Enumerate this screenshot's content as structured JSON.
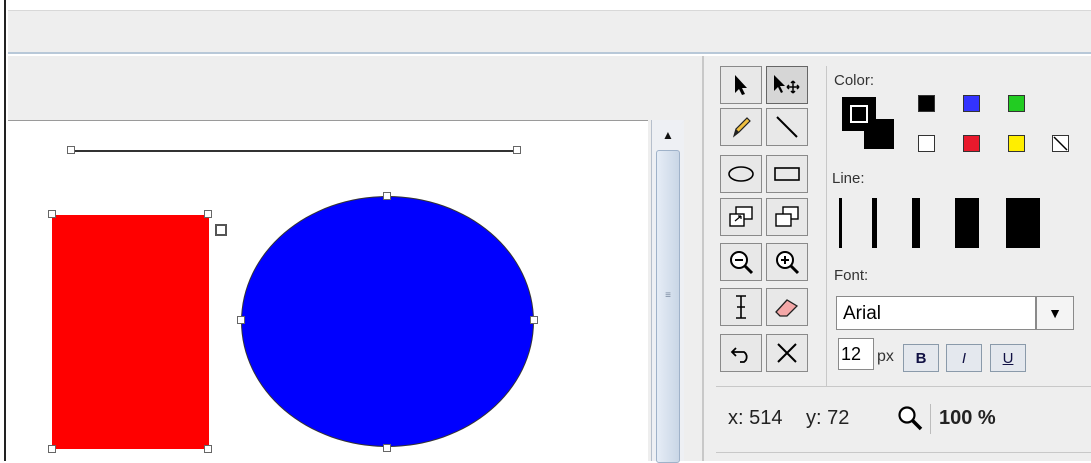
{
  "canvas": {
    "shapes": [
      "line-shape",
      "red-rectangle",
      "blue-ellipse"
    ],
    "colors": {
      "rect_fill": "#ff0000",
      "ellipse_fill": "#0000ff"
    }
  },
  "scrollbar": {
    "up_arrow": "▲",
    "grip": "≡"
  },
  "tools": {
    "select": "select-arrow-icon",
    "move": "move-arrow-icon",
    "pencil": "pencil-icon",
    "line": "line-icon",
    "ellipse": "ellipse-icon",
    "rectangle": "rectangle-icon",
    "resize_image": "resize-image-icon",
    "duplicate": "duplicate-icon",
    "zoom_out": "zoom-out-icon",
    "zoom_in": "zoom-in-icon",
    "text": "text-cursor-icon",
    "eraser": "eraser-icon",
    "undo": "undo-icon",
    "delete": "delete-x-icon"
  },
  "panel": {
    "color_label": "Color:",
    "line_label": "Line:",
    "font_label": "Font:",
    "font_name": "Arial",
    "font_size": "12",
    "size_unit": "px",
    "bold_label": "B",
    "italic_label": "I",
    "underline_label": "U",
    "dropdown_arrow": "▼"
  },
  "palette": [
    "#000000",
    "#3333ff",
    "#22cc22",
    "#ffffff",
    "#e8192c",
    "#ffee00",
    "none"
  ],
  "line_widths": [
    2,
    4,
    7,
    10,
    13
  ],
  "status": {
    "x_label": "x: 514",
    "y_label": "y: 72",
    "zoom": "100 %"
  }
}
